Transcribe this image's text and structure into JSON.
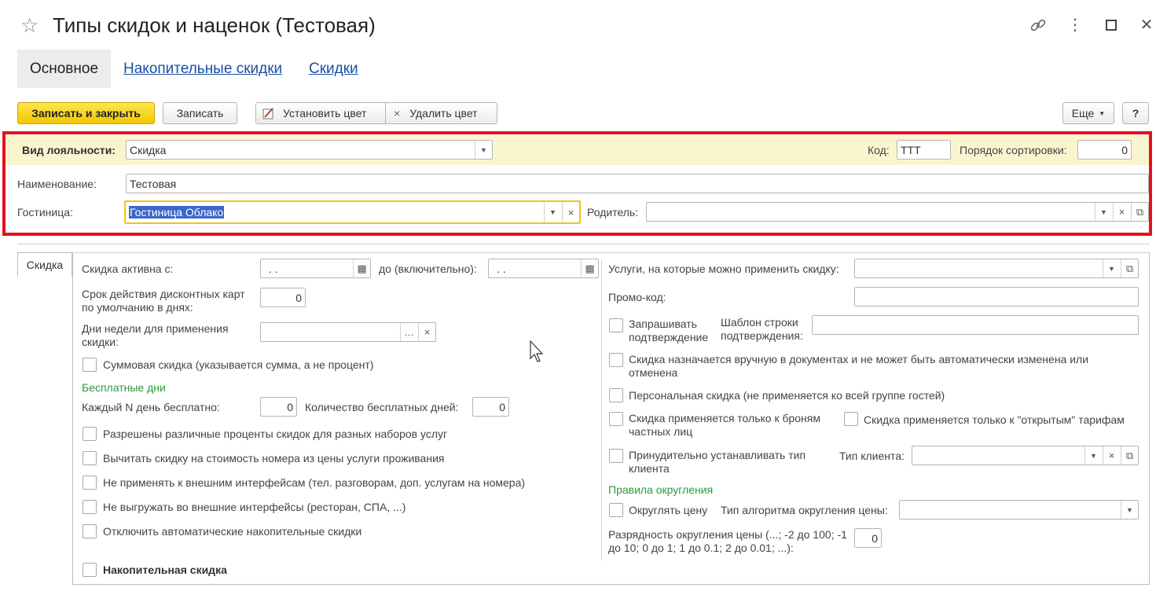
{
  "window": {
    "title": "Типы скидок и наценок (Тестовая)",
    "icons": [
      "star-icon",
      "link-icon",
      "more-icon",
      "maximize-icon",
      "close-icon"
    ]
  },
  "tabs": {
    "main": "Основное",
    "cumulative": "Накопительные скидки",
    "discounts": "Скидки"
  },
  "toolbar": {
    "save_close": "Записать и закрыть",
    "save": "Записать",
    "set_color": "Установить цвет",
    "delete_color": "Удалить цвет",
    "more": "Еще",
    "help": "?"
  },
  "header": {
    "loyalty_label": "Вид лояльности:",
    "loyalty_value": "Скидка",
    "code_label": "Код:",
    "code_value": "ТТТ",
    "sort_label": "Порядок сортировки:",
    "sort_value": "0",
    "name_label": "Наименование:",
    "name_value": "Тестовая",
    "hotel_label": "Гостиница:",
    "hotel_value": "Гостиница Облако",
    "parent_label": "Родитель:",
    "parent_value": ""
  },
  "panel": {
    "tab_label": "Скидка",
    "left": {
      "active_from_label": "Скидка активна с:",
      "active_from_value": " .  .",
      "to_label": "до (включительно):",
      "to_value": " .  .",
      "card_term_label": "Срок действия дисконтных карт по умолчанию в днях:",
      "card_term_value": "0",
      "weekdays_label": "Дни недели для применения скидки:",
      "weekdays_value": "",
      "sum_discount": "Суммовая скидка (указывается сумма, а не процент)",
      "free_days_header": "Бесплатные дни",
      "every_n_label": "Каждый N день бесплатно:",
      "every_n_value": "0",
      "free_count_label": "Количество бесплатных дней:",
      "free_count_value": "0",
      "checks": [
        "Разрешены различные проценты скидок для разных наборов услуг",
        "Вычитать скидку на стоимость номера из цены услуги проживания",
        "Не применять к внешним интерфейсам (тел. разговорам, доп. услугам на номера)",
        "Не выгружать во внешние интерфейсы (ресторан, СПА, ...)",
        "Отключить автоматические накопительные скидки"
      ],
      "cumulative_discount": "Накопительная скидка"
    },
    "right": {
      "services_label": "Услуги, на которые можно применить скидку:",
      "services_value": "",
      "promo_label": "Промо-код:",
      "promo_value": "",
      "ask_confirm": "Запрашивать подтверждение",
      "template_label": "Шаблон строки подтверждения:",
      "template_value": "",
      "manual_only": "Скидка назначается вручную в документах и не может быть автоматически изменена или отменена",
      "personal": "Персональная скидка (не применяется ко всей группе гостей)",
      "private_only": "Скидка применяется только к броням частных лиц",
      "open_rates_only": "Скидка применяется только к \"открытым\" тарифам",
      "force_client_type": "Принудительно устанавливать тип клиента",
      "client_type_label": "Тип клиента:",
      "client_type_value": "",
      "rounding_header": "Правила округления",
      "round_price": "Округлять цену",
      "round_algo_label": "Тип алгоритма округления цены:",
      "round_algo_value": "",
      "rounding_digits_label": "Разрядность округления цены (...; -2 до 100; -1 до 10; 0 до 1; 1 до 0.1; 2 до 0.01; ...):",
      "rounding_digits_value": "0"
    }
  }
}
